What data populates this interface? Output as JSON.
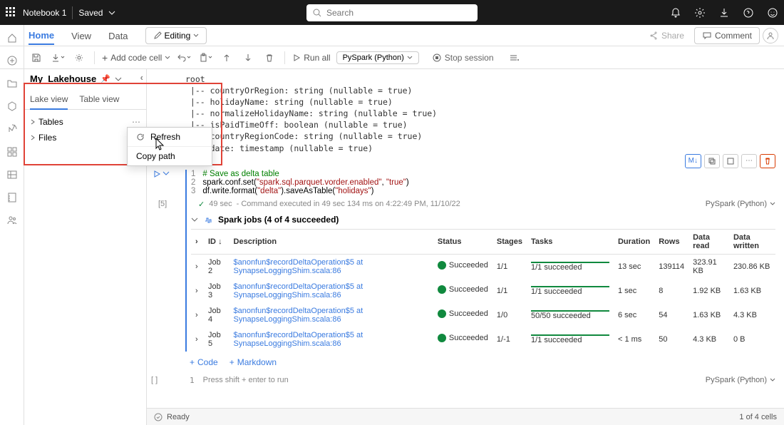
{
  "topbar": {
    "title": "Notebook 1",
    "saved": "Saved",
    "search_placeholder": "Search"
  },
  "tabs": {
    "home": "Home",
    "view": "View",
    "data": "Data",
    "editing": "Editing",
    "share": "Share",
    "comment": "Comment"
  },
  "toolbar": {
    "add_code": "Add code cell",
    "run_all": "Run all",
    "kernel": "PySpark (Python)",
    "stop": "Stop session"
  },
  "lakehouse": {
    "title": "My_Lakehouse",
    "lake_view": "Lake view",
    "table_view": "Table view",
    "tables": "Tables",
    "files": "Files"
  },
  "context": {
    "refresh": "Refresh",
    "copy_path": "Copy path"
  },
  "schema": "root\n |-- countryOrRegion: string (nullable = true)\n |-- holidayName: string (nullable = true)\n |-- normalizeHolidayName: string (nullable = true)\n |-- isPaidTimeOff: boolean (nullable = true)\n |-- countryRegionCode: string (nullable = true)\n |-- date: timestamp (nullable = true)",
  "cell2": {
    "md_action": "M↓",
    "line1_comment": "# Save as delta table",
    "line2a": "spark.conf.set(",
    "line2s1": "\"spark.sql.parquet.vorder.enabled\"",
    "line2m": ", ",
    "line2s2": "\"true\"",
    "line2e": ")",
    "line3a": "df.write.format(",
    "line3s1": "\"delta\"",
    "line3m": ").saveAsTable(",
    "line3s2": "\"holidays\"",
    "line3e": ")",
    "label": "[5]"
  },
  "exec": {
    "time": "49 sec",
    "detail": "- Command executed in 49 sec 134 ms on 4:22:49 PM, 11/10/22",
    "kernel": "PySpark (Python)"
  },
  "spark": {
    "header": "Spark jobs (4 of 4 succeeded)",
    "heads": {
      "id": "ID",
      "desc": "Description",
      "status": "Status",
      "stages": "Stages",
      "tasks": "Tasks",
      "duration": "Duration",
      "rows": "Rows",
      "read": "Data read",
      "written": "Data written"
    },
    "sort": "↓",
    "rows": [
      {
        "id": "Job 2",
        "desc": "$anonfun$recordDeltaOperation$5 at SynapseLoggingShim.scala:86",
        "status": "Succeeded",
        "stages": "1/1",
        "tasks": "1/1 succeeded",
        "duration": "13 sec",
        "rows": "139114",
        "read": "323.91 KB",
        "written": "230.86 KB"
      },
      {
        "id": "Job 3",
        "desc": "$anonfun$recordDeltaOperation$5 at SynapseLoggingShim.scala:86",
        "status": "Succeeded",
        "stages": "1/1",
        "tasks": "1/1 succeeded",
        "duration": "1 sec",
        "rows": "8",
        "read": "1.92 KB",
        "written": "1.63 KB"
      },
      {
        "id": "Job 4",
        "desc": "$anonfun$recordDeltaOperation$5 at SynapseLoggingShim.scala:86",
        "status": "Succeeded",
        "stages": "1/0",
        "tasks": "50/50 succeeded",
        "duration": "6 sec",
        "rows": "54",
        "read": "1.63 KB",
        "written": "4.3 KB"
      },
      {
        "id": "Job 5",
        "desc": "$anonfun$recordDeltaOperation$5 at SynapseLoggingShim.scala:86",
        "status": "Succeeded",
        "stages": "1/-1",
        "tasks": "1/1 succeeded",
        "duration": "< 1 ms",
        "rows": "50",
        "read": "4.3 KB",
        "written": "0 B"
      }
    ]
  },
  "add": {
    "code": "Code",
    "markdown": "Markdown"
  },
  "empty": {
    "num": "1",
    "hint": "Press shift + enter to run",
    "label": "[ ]",
    "kernel": "PySpark (Python)"
  },
  "status": {
    "ready": "Ready",
    "cells": "1 of 4 cells"
  }
}
